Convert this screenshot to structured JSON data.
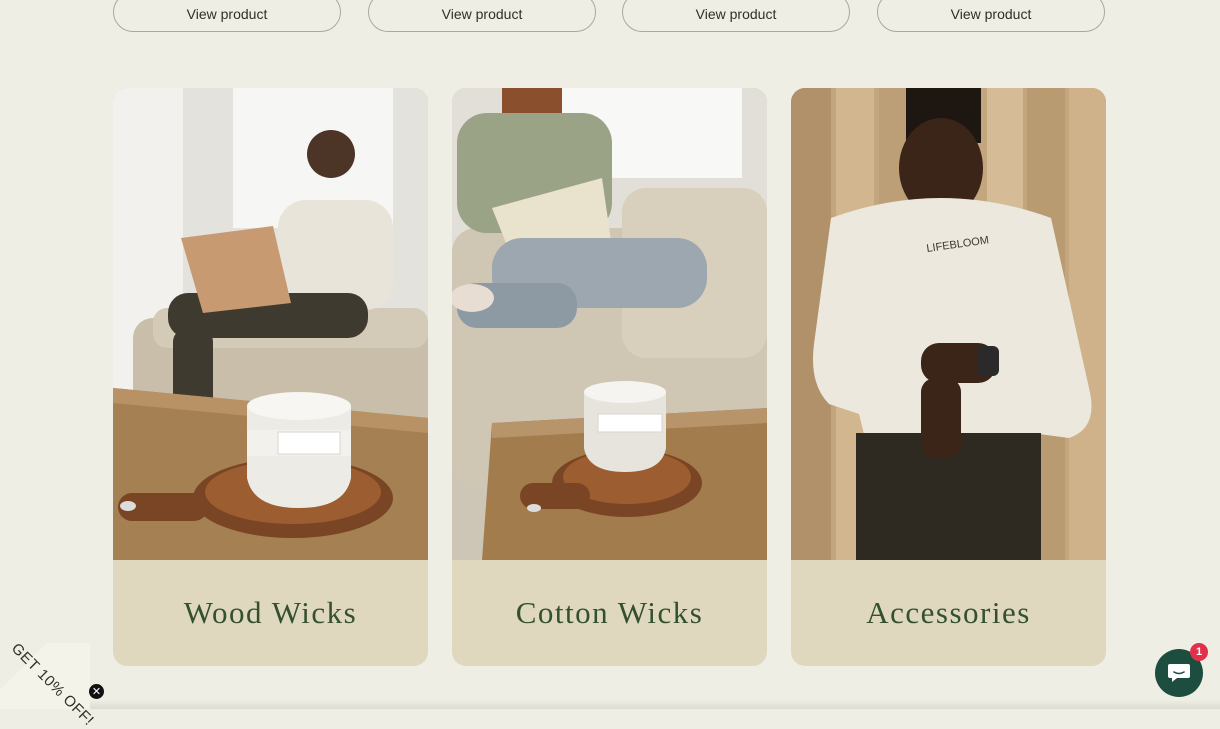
{
  "products": {
    "view_buttons": [
      "View product",
      "View product",
      "View product",
      "View product"
    ]
  },
  "collections": [
    {
      "title": "Wood Wicks"
    },
    {
      "title": "Cotton Wicks"
    },
    {
      "title": "Accessories"
    }
  ],
  "apparel_print": "LIFEBLOOM",
  "promo": {
    "label": "GET 10% OFF!",
    "close_label": "✕"
  },
  "chat": {
    "badge_count": "1"
  },
  "colors": {
    "page_bg": "#efeee4",
    "card_footer": "#dfd8bf",
    "title_green": "#33502f",
    "chat_green": "#1d4d3e",
    "badge_red": "#e1304a"
  }
}
